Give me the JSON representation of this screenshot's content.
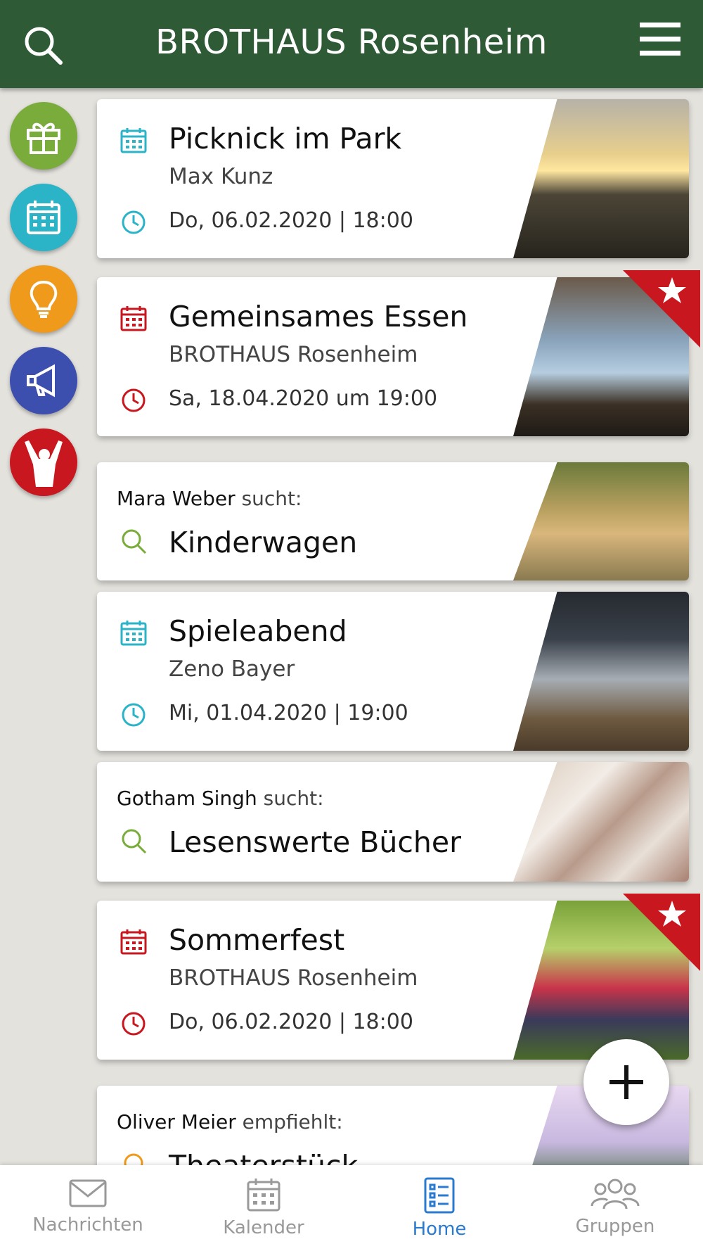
{
  "header": {
    "title": "BROTHAUS Rosenheim"
  },
  "rail": [
    {
      "name": "gift",
      "color": "#7aac3c"
    },
    {
      "name": "calendar",
      "color": "#2bb3c8"
    },
    {
      "name": "idea",
      "color": "#f09a1c"
    },
    {
      "name": "announce",
      "color": "#3d4fae"
    },
    {
      "name": "cheer",
      "color": "#c8171e"
    }
  ],
  "cards": [
    {
      "type": "event",
      "title": "Picknick im Park",
      "organizer": "Max Kunz",
      "datetime": "Do, 06.02.2020 | 18:00",
      "color": "#2bb3c8",
      "featured": false
    },
    {
      "type": "event",
      "title": "Gemeinsames Essen",
      "organizer": "BROTHAUS Rosenheim",
      "datetime": "Sa, 18.04.2020 um 19:00",
      "color": "#c8171e",
      "featured": true
    },
    {
      "type": "search",
      "person": "Mara Weber",
      "action": "sucht:",
      "title": "Kinderwagen",
      "color": "#7aac3c"
    },
    {
      "type": "event",
      "title": "Spieleabend",
      "organizer": "Zeno Bayer",
      "datetime": "Mi, 01.04.2020 | 19:00",
      "color": "#2bb3c8",
      "featured": false
    },
    {
      "type": "search",
      "person": "Gotham Singh",
      "action": "sucht:",
      "title": "Lesenswerte Bücher",
      "color": "#7aac3c"
    },
    {
      "type": "event",
      "title": "Sommerfest",
      "organizer": "BROTHAUS Rosenheim",
      "datetime": "Do, 06.02.2020 | 18:00",
      "color": "#c8171e",
      "featured": true
    },
    {
      "type": "recommend",
      "person": "Oliver Meier",
      "action": "empfiehlt:",
      "title": "Theaterstück",
      "color": "#f09a1c"
    }
  ],
  "tabs": [
    {
      "label": "Nachrichten",
      "icon": "envelope-icon",
      "active": false
    },
    {
      "label": "Kalender",
      "icon": "calendar-icon",
      "active": false
    },
    {
      "label": "Home",
      "icon": "list-icon",
      "active": true
    },
    {
      "label": "Gruppen",
      "icon": "group-icon",
      "active": false
    }
  ],
  "colors": {
    "header": "#2e5a36",
    "accent": "#2a7bd0",
    "ribbon": "#c8171e"
  }
}
